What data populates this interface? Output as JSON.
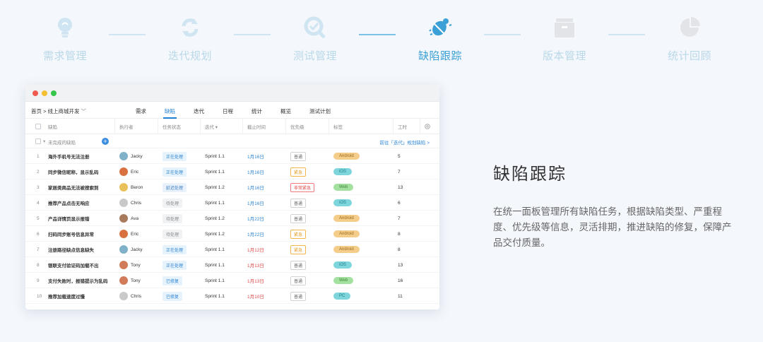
{
  "steps": [
    {
      "label": "需求管理",
      "icon": "lightbulb-icon"
    },
    {
      "label": "迭代规划",
      "icon": "cycle-arrows-icon"
    },
    {
      "label": "测试管理",
      "icon": "magnifier-check-icon"
    },
    {
      "label": "缺陷跟踪",
      "icon": "bug-icon"
    },
    {
      "label": "版本管理",
      "icon": "archive-box-icon"
    },
    {
      "label": "统计回顾",
      "icon": "pie-chart-icon"
    }
  ],
  "active_step": "缺陷跟踪",
  "colors": {
    "accent": "#3aa0d6",
    "inactive": "#b9d8e8",
    "link": "#1f7fd1"
  },
  "app": {
    "breadcrumb": "首页 > 线上商城开发",
    "tabs": [
      "需求",
      "缺陷",
      "迭代",
      "日程",
      "统计",
      "概览",
      "测试计划"
    ],
    "active_tab": "缺陷",
    "columns": {
      "title": "缺陷",
      "owner": "执行者",
      "status": "任务状态",
      "sprint": "迭代 ▾",
      "due": "截止时间",
      "priority": "优先级",
      "tag": "标签",
      "hours": "工时"
    },
    "group_label": "未完成的缺陷",
    "group_link": "前往「迭代」规划缺陷  >",
    "rows": [
      {
        "n": "1",
        "title": "海外手机号无法注册",
        "owner": "Jacky",
        "status": "正在处理",
        "sprint": "Sprint 1.1",
        "due": "1月16日",
        "prio": "普通",
        "tag": "Android",
        "hours": "5"
      },
      {
        "n": "2",
        "title": "同步微信昵称，显示乱码",
        "owner": "Eric",
        "status": "正在处理",
        "sprint": "Sprint 1.1",
        "due": "1月16日",
        "prio": "紧急",
        "tag": "iOS",
        "hours": "7"
      },
      {
        "n": "3",
        "title": "家居类商品无法被搜索到",
        "owner": "Beron",
        "status": "延迟处理",
        "sprint": "Sprint 1.2",
        "due": "1月16日",
        "prio": "非常紧急",
        "tag": "Web",
        "hours": "13"
      },
      {
        "n": "4",
        "title": "推荐产品点击无响应",
        "owner": "Chris",
        "status": "待处理",
        "sprint": "Sprint 1.1",
        "due": "1月16日",
        "prio": "普通",
        "tag": "iOS",
        "hours": "6"
      },
      {
        "n": "5",
        "title": "产品详情页显示报错",
        "owner": "Ava",
        "status": "待处理",
        "sprint": "Sprint 1.2",
        "due": "1月22日",
        "prio": "普通",
        "tag": "Android",
        "hours": "7"
      },
      {
        "n": "6",
        "title": "扫码同步账号信息异常",
        "owner": "Eric",
        "status": "待处理",
        "sprint": "Sprint 1.2",
        "due": "1月22日",
        "prio": "紧急",
        "tag": "Android",
        "hours": "8"
      },
      {
        "n": "7",
        "title": "注册路径缺点信息缺失",
        "owner": "Jacky",
        "status": "正在处理",
        "sprint": "Sprint 1.1",
        "due": "1月12日",
        "prio": "紧急",
        "tag": "Android",
        "hours": "8"
      },
      {
        "n": "8",
        "title": "银联支付验证码加载不出",
        "owner": "Tony",
        "status": "正在处理",
        "sprint": "Sprint 1.1",
        "due": "1月13日",
        "prio": "普通",
        "tag": "iOS",
        "hours": "13"
      },
      {
        "n": "9",
        "title": "支付失败时，报错提示为乱码",
        "owner": "Tony",
        "status": "已修复",
        "sprint": "Sprint 1.1",
        "due": "1月13日",
        "prio": "普通",
        "tag": "Web",
        "hours": "16"
      },
      {
        "n": "10",
        "title": "推荐加载速度过慢",
        "owner": "Chris",
        "status": "已修复",
        "sprint": "Sprint 1.1",
        "due": "1月10日",
        "prio": "普通",
        "tag": "PC",
        "hours": "11"
      }
    ]
  },
  "feature": {
    "title": "缺陷跟踪",
    "description": "在统一面板管理所有缺陷任务，根据缺陷类型、严重程度、优先级等信息，灵活排期，推进缺陷的修复，保障产品交付质量。"
  }
}
